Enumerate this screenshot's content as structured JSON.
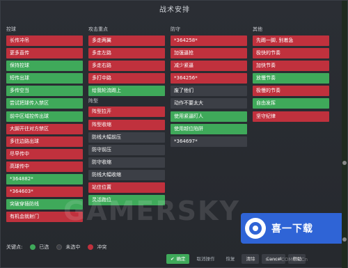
{
  "window": {
    "title": "战术安排"
  },
  "columns": {
    "control": {
      "title": "控球",
      "items": [
        {
          "label": "长传冲吊",
          "state": "red"
        },
        {
          "label": "更多直传",
          "state": "red"
        },
        {
          "label": "保持控球",
          "state": "green"
        },
        {
          "label": "短传出球",
          "state": "green"
        },
        {
          "label": "多传空当",
          "state": "green"
        },
        {
          "label": "尝试把球传入禁区",
          "state": "green"
        },
        {
          "label": "前中区域控传出球",
          "state": "green"
        },
        {
          "label": "大脚开往对方禁区",
          "state": "red"
        },
        {
          "label": "多往边路出球",
          "state": "red"
        },
        {
          "label": "尽早传中",
          "state": "red"
        },
        {
          "label": "高球传中",
          "state": "red"
        },
        {
          "label": "*364882*",
          "state": "green"
        },
        {
          "label": "*364603*",
          "state": "red"
        },
        {
          "label": "突破穿插防线",
          "state": "green"
        },
        {
          "label": "有机会就射门",
          "state": "red"
        }
      ]
    },
    "attack": {
      "title": "攻击重点",
      "items": [
        {
          "label": "多走两翼",
          "state": "red"
        },
        {
          "label": "多走左路",
          "state": "red"
        },
        {
          "label": "多走右路",
          "state": "red"
        },
        {
          "label": "多打中路",
          "state": "red"
        },
        {
          "label": "给我轮流踢上",
          "state": "green"
        }
      ],
      "sub_title": "阵型",
      "sub_items": [
        {
          "label": "阵型拉开",
          "state": "red"
        },
        {
          "label": "阵型收缩",
          "state": "red"
        },
        {
          "label": "防线大幅前压",
          "state": "dark"
        },
        {
          "label": "防守前压",
          "state": "dark"
        },
        {
          "label": "防守收缩",
          "state": "dark"
        },
        {
          "label": "防线大幅收缩",
          "state": "dark"
        },
        {
          "label": "站住位置",
          "state": "red"
        },
        {
          "label": "灵活跑位",
          "state": "green"
        }
      ]
    },
    "defense": {
      "title": "防守",
      "items": [
        {
          "label": "*364258*",
          "state": "red"
        },
        {
          "label": "加强逼抢",
          "state": "red"
        },
        {
          "label": "减少紧逼",
          "state": "red"
        },
        {
          "label": "*364256*",
          "state": "red"
        },
        {
          "label": "废了他们",
          "state": "dark"
        },
        {
          "label": "动作不要太大",
          "state": "dark"
        },
        {
          "label": "使用紧逼盯人",
          "state": "green"
        },
        {
          "label": "使用越位陷阱",
          "state": "green"
        },
        {
          "label": "*364697*",
          "state": "dark"
        }
      ]
    },
    "other": {
      "title": "其他",
      "items": [
        {
          "label": "先踢一脚, 别着急",
          "state": "red"
        },
        {
          "label": "极快的节奏",
          "state": "red"
        },
        {
          "label": "加快节奏",
          "state": "red"
        },
        {
          "label": "放慢节奏",
          "state": "green"
        },
        {
          "label": "极慢的节奏",
          "state": "red"
        },
        {
          "label": "自由发挥",
          "state": "green"
        },
        {
          "label": "坚守纪律",
          "state": "red"
        }
      ]
    }
  },
  "legend": {
    "title": "关键点:",
    "selected": "已选",
    "unselected": "未选中",
    "conflict": "冲突"
  },
  "buttons": {
    "ok": "确定",
    "cancel_action": "取消操作",
    "restore": "恢复",
    "clear": "清除",
    "cancel": "Cancel",
    "help": "帮助"
  },
  "promo": {
    "text": "喜一下载"
  },
  "watermark": {
    "text": "GAMERSKY",
    "url": "www.PCOMCN.Cn"
  },
  "colors": {
    "red": "#c0313d",
    "green": "#3fa95a",
    "dark": "#3c3f46"
  }
}
